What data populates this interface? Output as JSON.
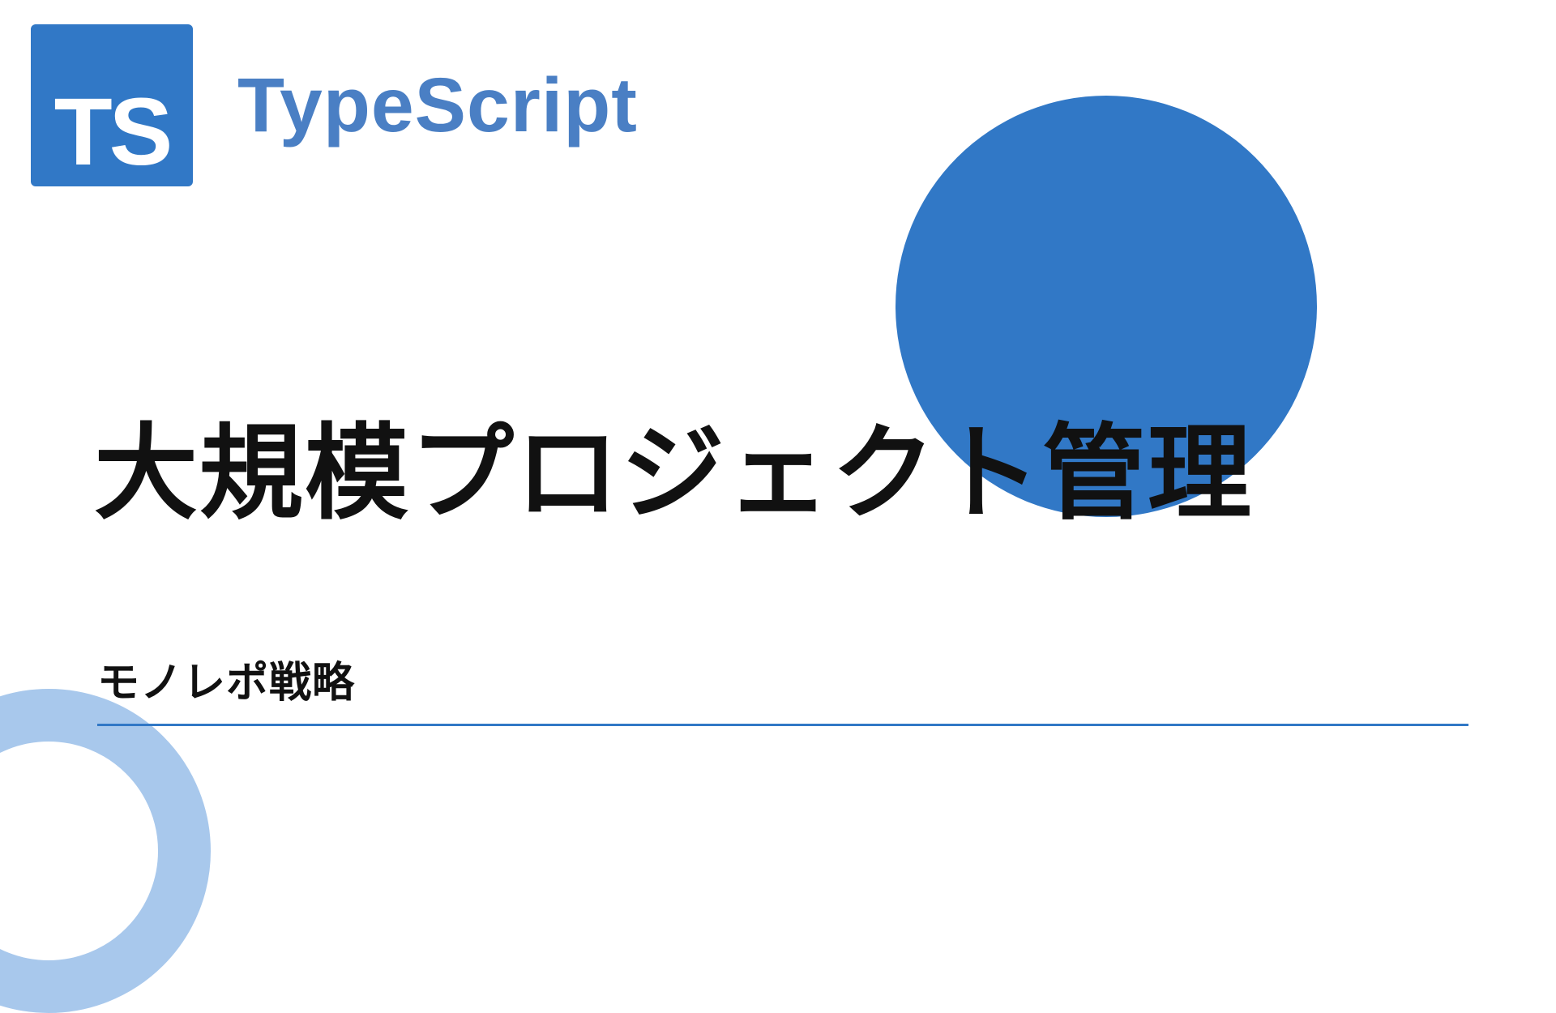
{
  "logo": {
    "badge_text": "TS",
    "label": "TypeScript"
  },
  "main_title": "大規模プロジェクト管理",
  "subtitle": "モノレポ戦略",
  "colors": {
    "primary": "#3178c6",
    "ring": "#a8c8ec",
    "text": "#111"
  }
}
